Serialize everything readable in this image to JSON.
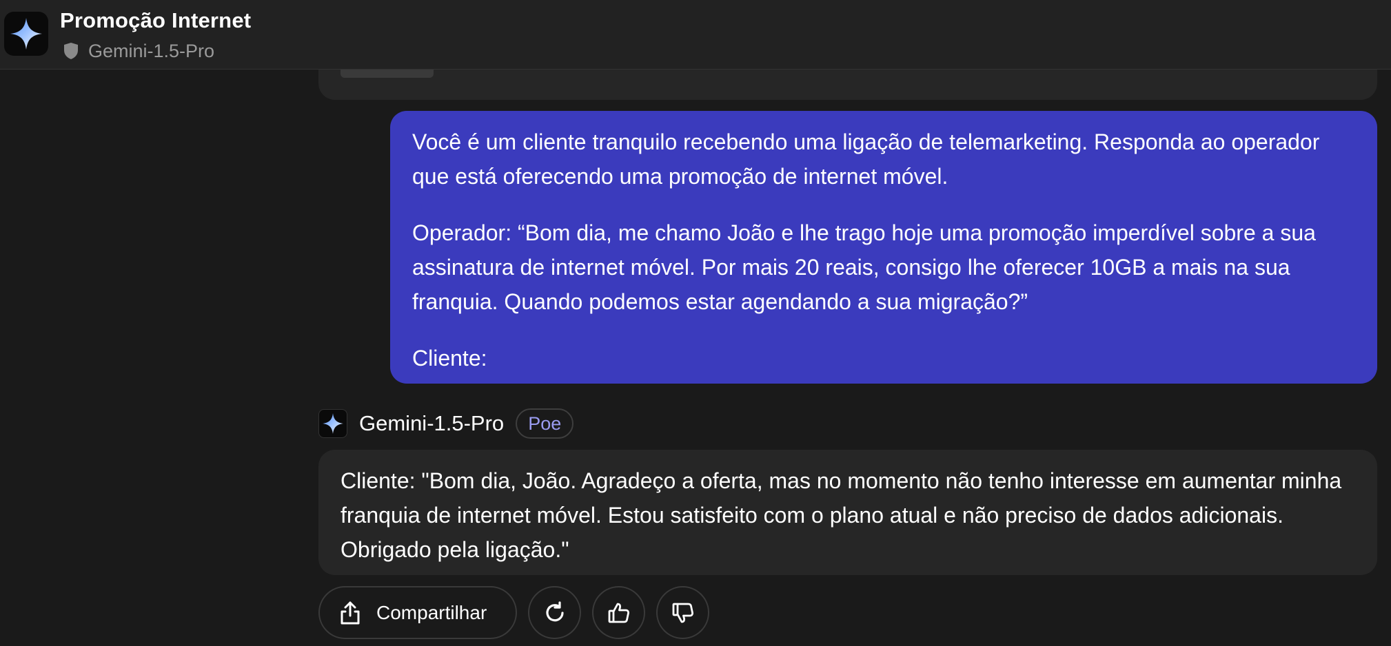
{
  "header": {
    "title": "Promoção Internet",
    "bot_name": "Gemini-1.5-Pro"
  },
  "user_message": {
    "paragraphs": [
      "Você é um cliente tranquilo recebendo uma ligação de telemarketing. Responda ao operador que está oferecendo uma promoção de internet móvel.",
      "Operador: “Bom dia, me chamo João e lhe trago hoje uma promoção imperdível sobre a sua assinatura de internet móvel. Por mais 20 reais, consigo lhe oferecer 10GB a mais na sua franquia. Quando podemos estar agendando a sua migração?”",
      "Cliente:"
    ]
  },
  "bot_message": {
    "bot_name": "Gemini-1.5-Pro",
    "badge": "Poe",
    "text": "Cliente: \"Bom dia, João. Agradeço a oferta, mas no momento não tenho interesse em aumentar minha franquia de internet móvel. Estou satisfeito com o plano atual e não preciso de dados adicionais. Obrigado pela ligação.\""
  },
  "actions": {
    "share_label": "Compartilhar",
    "icons": [
      "share-icon",
      "retry-icon",
      "thumbs-up-icon",
      "thumbs-down-icon"
    ]
  },
  "colors": {
    "background": "#1a1a1a",
    "header": "#222222",
    "user_bubble": "#3b3bbd",
    "bot_bubble": "#262626",
    "badge_text": "#9a9cf0"
  }
}
